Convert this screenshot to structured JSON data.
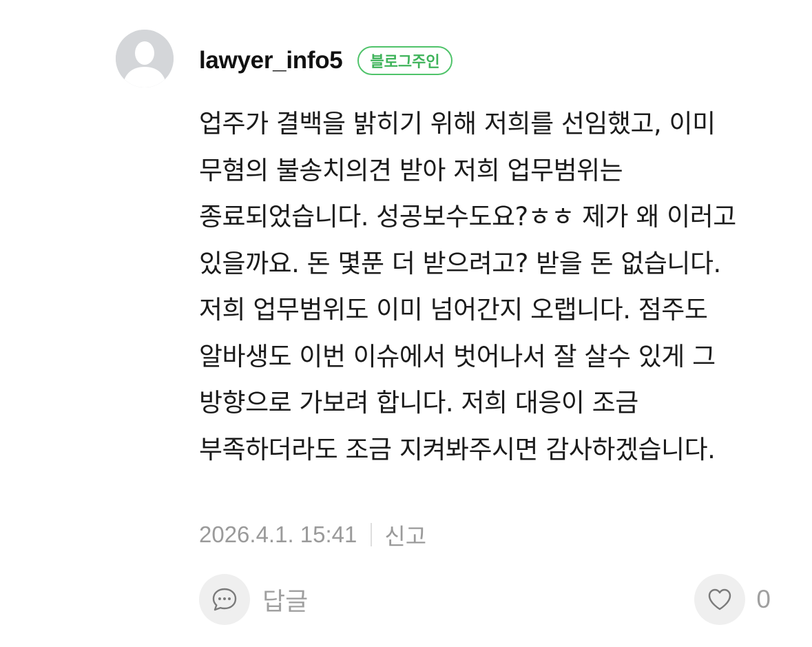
{
  "comment": {
    "author": "lawyer_info5",
    "badge": "블로그주인",
    "text": "업주가 결백을 밝히기 위해 저희를 선임했고, 이미 무혐의 불송치의견 받아 저희 업무범위는 종료되었습니다. 성공보수도요?ㅎㅎ 제가 왜 이러고 있을까요. 돈 몇푼 더 받으려고? 받을 돈 없습니다. 저희 업무범위도 이미 넘어간지 오랩니다. 점주도 알바생도 이번 이슈에서 벗어나서 잘 살수 있게 그 방향으로 가보려 합니다. 저희 대응이 조금 부족하더라도 조금 지켜봐주시면 감사하겠습니다.",
    "date": "2026.4.1. 15:41",
    "report_label": "신고"
  },
  "actions": {
    "reply_label": "답글",
    "like_count": "0"
  },
  "icons": {
    "avatar": "default-profile-icon",
    "reply": "speech-bubble-icon",
    "like": "heart-outline-icon"
  },
  "colors": {
    "badge": "#4fc36a",
    "muted_text": "#9a9a9a",
    "button_bg": "#efefef"
  }
}
